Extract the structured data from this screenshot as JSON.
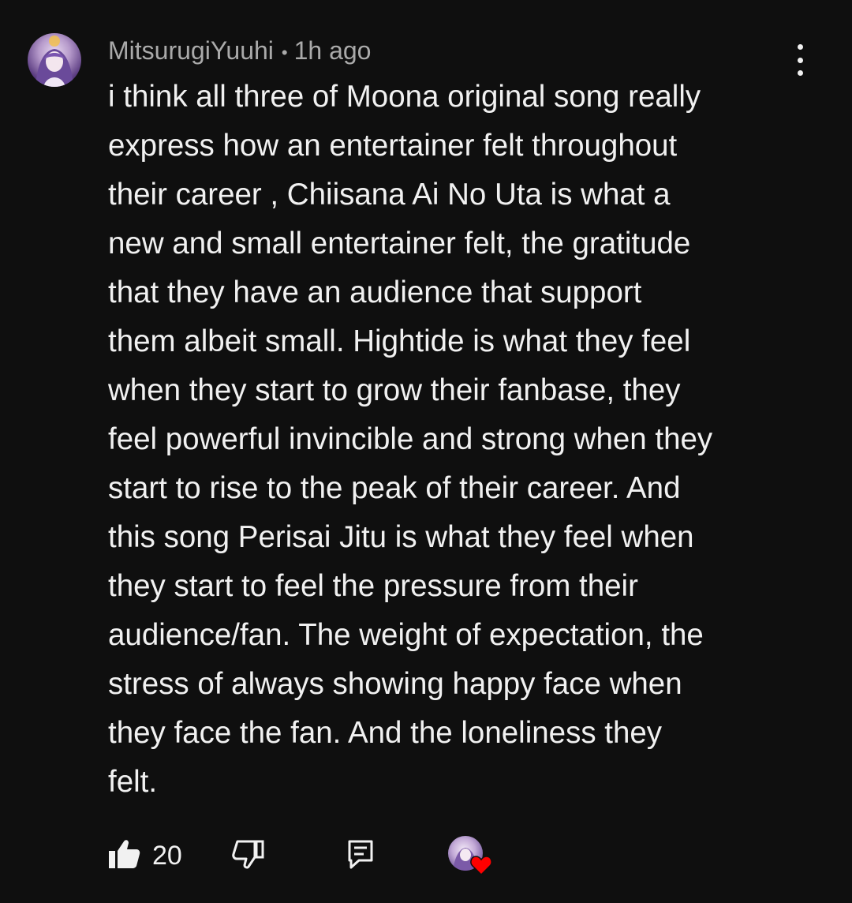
{
  "comment": {
    "author": "MitsurugiYuuhi",
    "separator": "•",
    "time": "1h ago",
    "lines": [
      "i think all three of Moona original song really",
      "express how an entertainer felt throughout",
      "their career , Chiisana Ai No Uta is what a",
      "new and small entertainer felt, the gratitude",
      "that they have an audience that support",
      "them albeit small. Hightide is what they feel",
      "when they start to grow their fanbase, they",
      "feel powerful invincible and strong when they",
      "start to rise to the peak of their career. And",
      "this song Perisai Jitu is what they feel when",
      "they start to feel the pressure from their",
      "audience/fan. The weight of expectation, the",
      "stress of always showing happy face when",
      "they face the fan. And the loneliness they",
      "felt."
    ]
  },
  "actions": {
    "like_count": "20",
    "icons": {
      "like": "thumbs-up-icon",
      "dislike": "thumbs-down-icon",
      "reply": "reply-icon",
      "menu": "more-vertical-icon",
      "creator_heart": "heart-icon"
    }
  },
  "colors": {
    "background": "#0f0f0f",
    "text_primary": "#f1f1f1",
    "text_secondary": "#aaaaaa",
    "heart": "#ff0000"
  }
}
